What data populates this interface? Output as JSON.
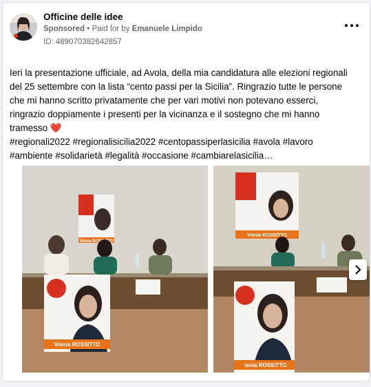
{
  "post": {
    "page_name": "Officine delle idee",
    "sponsored_label": "Sponsored",
    "separator": " • ",
    "paid_for_prefix": "Paid for by ",
    "paid_for_name": "Emanuele Limpido",
    "id_line": "ID: 489070382642857",
    "text_lines": [
      "Ieri la presentazione ufficiale, ad Avola, della mia candidatura alle elezioni regionali",
      "del 25 settembre con la lista “cento passi per la Sicilia”. Ringrazio tutte le persone",
      "che mi hanno scritto privatamente che per vari motivi non potevano esserci,",
      "ringrazio doppiamente i presenti per la vicinanza e il sostegno che mi hanno",
      "tramesso"
    ],
    "heart_emoji": "❤️",
    "hashtags_line1": "#regionali2022 #regionalisicilia2022 #centopassiperlasicilia #avola #lavoro",
    "hashtags_line2": "#ambiente #solidarietà #legalità #occasione #cambiarelasicilia…"
  },
  "images": {
    "poster_name": "Vienia ROSSITTO",
    "poster_brand": "FAVA cento passi",
    "poster_name_alt": "ienia ROSSITTO"
  },
  "icons": {
    "more": "more-options-icon",
    "next": "chevron-right-icon"
  },
  "colors": {
    "poster_orange": "#e8731a",
    "poster_red": "#d7301f",
    "heart": "#e0245e",
    "secondary_text": "#65676b"
  }
}
